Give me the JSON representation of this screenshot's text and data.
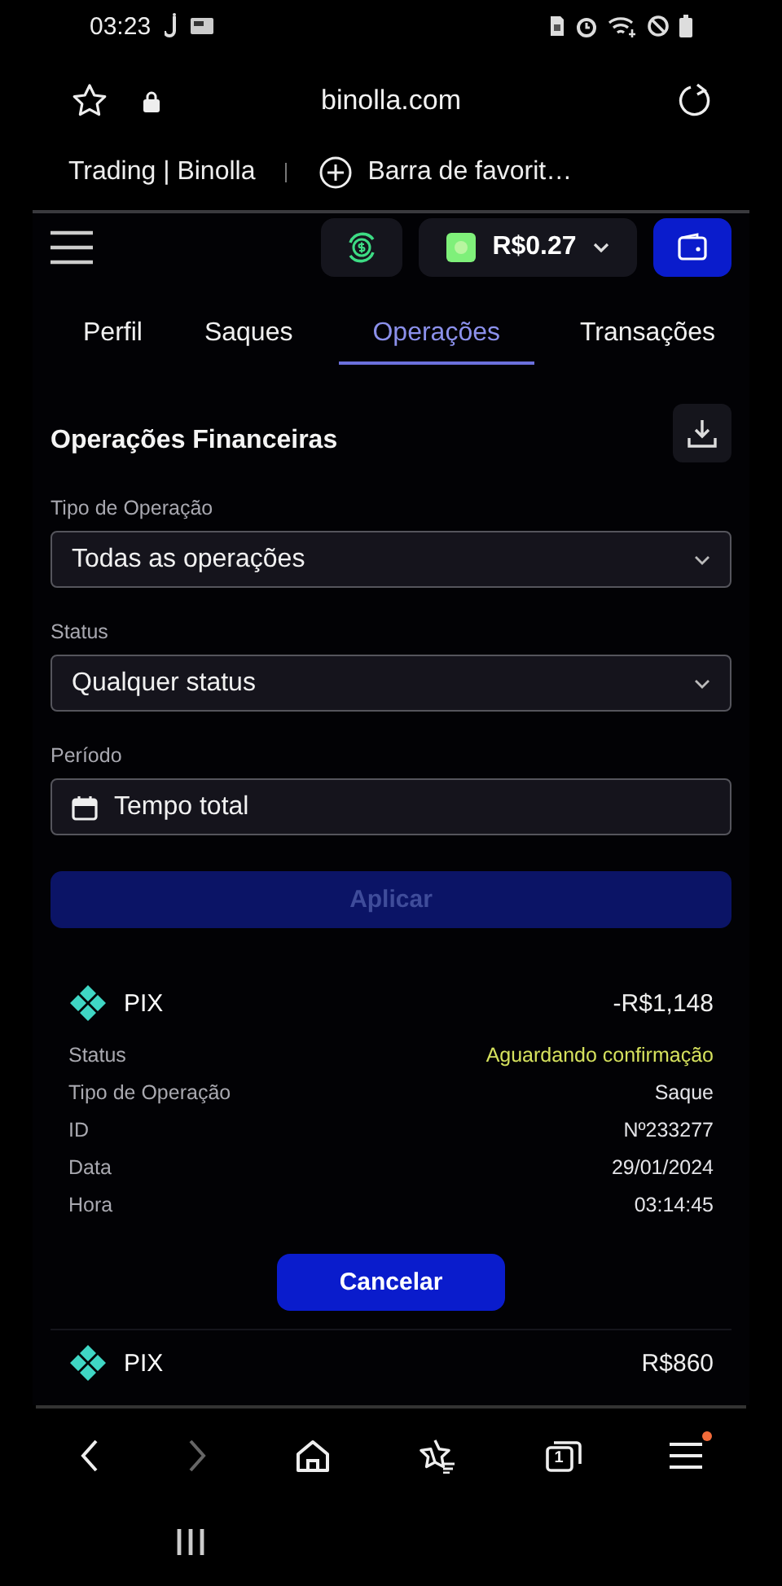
{
  "status_bar": {
    "time": "03:23"
  },
  "browser": {
    "url": "binolla.com",
    "bookmarks": [
      {
        "label": "Trading | Binolla"
      }
    ],
    "add_bookmark": "Barra de favorit…"
  },
  "app_header": {
    "balance": "R$0.27"
  },
  "tabs": [
    {
      "label": "Perfil",
      "selected": false
    },
    {
      "label": "Saques",
      "selected": false
    },
    {
      "label": "Operações",
      "selected": true
    },
    {
      "label": "Transações",
      "selected": false
    }
  ],
  "section": {
    "title": "Operações Financeiras"
  },
  "filters": [
    {
      "label": "Tipo de Operação",
      "value": "Todas as operações",
      "kind": "select"
    },
    {
      "label": "Status",
      "value": "Qualquer status",
      "kind": "select"
    },
    {
      "label": "Período",
      "value": "Tempo total",
      "kind": "date"
    }
  ],
  "apply_button": {
    "label": "Aplicar",
    "disabled": true
  },
  "operations": [
    {
      "method": "PIX",
      "amount": "-R$1,148",
      "details": [
        {
          "label": "Status",
          "value": "Aguardando confirmação",
          "color": "#d6e25e"
        },
        {
          "label": "Tipo de Operação",
          "value": "Saque",
          "color": "#e4e4e8"
        },
        {
          "label": "ID",
          "value": "Nº233277",
          "color": "#e4e4e8"
        },
        {
          "label": "Data",
          "value": "29/01/2024",
          "color": "#e4e4e8"
        },
        {
          "label": "Hora",
          "value": "03:14:45",
          "color": "#e4e4e8"
        }
      ],
      "action": "Cancelar"
    },
    {
      "method": "PIX",
      "amount": "R$860"
    }
  ],
  "bottom_nav": {
    "forward_disabled": true,
    "tabs_count": "1",
    "menu_badge": true
  }
}
